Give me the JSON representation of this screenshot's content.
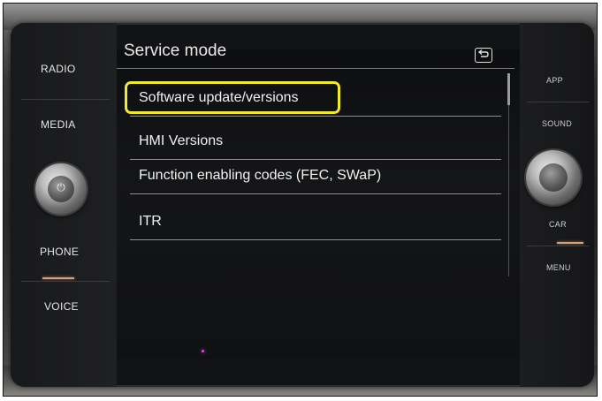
{
  "hardware": {
    "left_buttons": [
      "RADIO",
      "MEDIA",
      "PHONE",
      "VOICE"
    ],
    "right_buttons": [
      "APP",
      "SOUND",
      "CAR",
      "MENU"
    ]
  },
  "screen": {
    "title": "Service mode",
    "back_icon": "back-arrow-icon",
    "menu_items": [
      "Software update/versions",
      "HMI Versions",
      "Function enabling codes (FEC, SWaP)",
      "ITR"
    ],
    "highlighted_item": "Software update/versions",
    "highlight_color": "#f2ea2b",
    "accent_color": "#3c7fd8"
  }
}
